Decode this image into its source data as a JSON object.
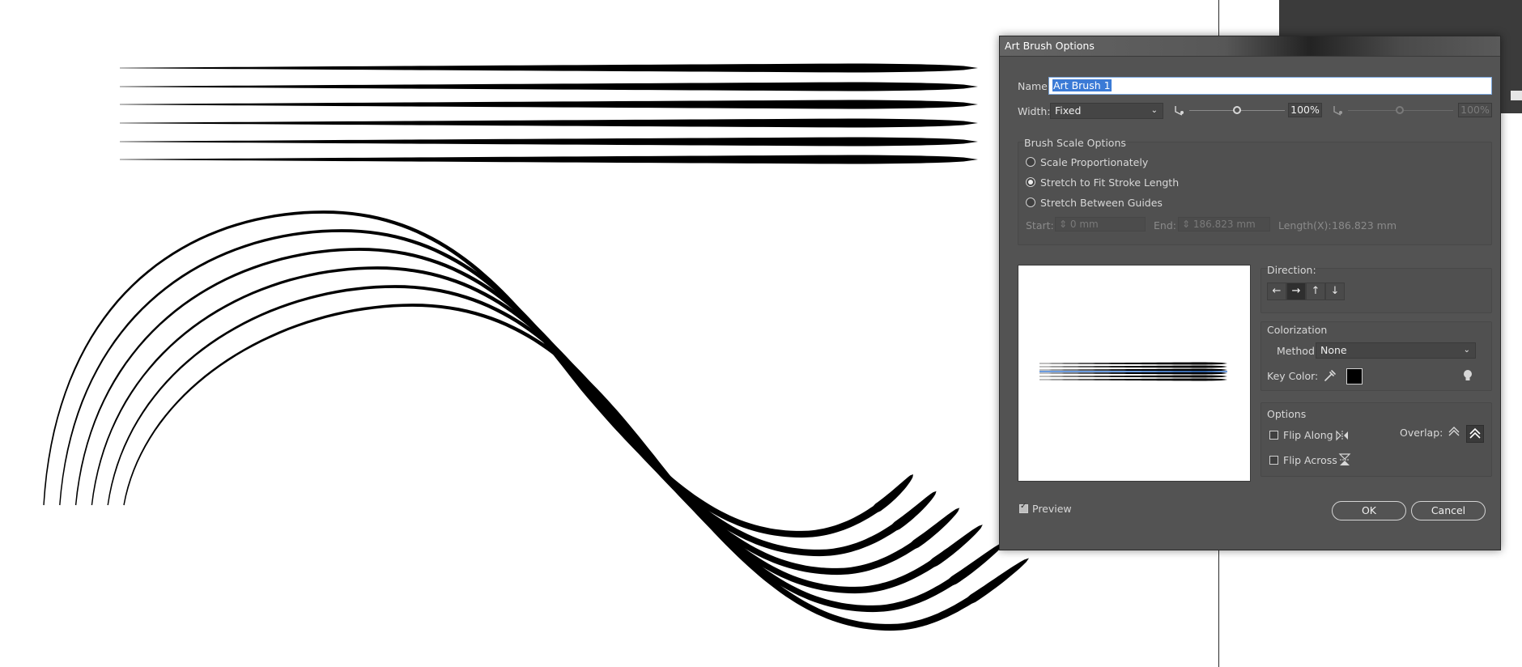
{
  "dialog": {
    "title": "Art Brush Options",
    "name_label": "Name:",
    "name_value": "Art Brush 1",
    "width_label": "Width:",
    "width_option": "Fixed",
    "width_percent": "100%",
    "width_percent_2": "100%",
    "width_slider_value": 0.5,
    "brush_scale": {
      "title": "Brush Scale Options",
      "options": [
        "Scale Proportionately",
        "Stretch to Fit Stroke Length",
        "Stretch Between Guides"
      ],
      "selected_index": 1,
      "start_label": "Start:",
      "start_value": "0 mm",
      "end_label": "End:",
      "end_value": "186.823 mm",
      "length_label": "Length(X):",
      "length_value": "186.823 mm"
    },
    "direction": {
      "title": "Direction:",
      "buttons": [
        "←",
        "→",
        "↑",
        "↓"
      ],
      "selected_index": 1
    },
    "colorization": {
      "title": "Colorization",
      "method_label": "Method:",
      "method_value": "None",
      "key_color_label": "Key Color:",
      "key_color": "#000000"
    },
    "options": {
      "title": "Options",
      "flip_along": "Flip Along",
      "flip_across": "Flip Across",
      "overlap_label": "Overlap:"
    },
    "preview_label": "Preview",
    "preview_checked": true,
    "ok_label": "OK",
    "cancel_label": "Cancel",
    "icons": {
      "width_left": "pressure-left-icon",
      "width_right": "pressure-right-icon",
      "eyedropper": "eyedropper-icon",
      "tips": "lightbulb-icon",
      "flip_along": "flip-along-icon",
      "flip_across": "flip-across-icon",
      "overlap_1": "overlap-adjust-icon",
      "overlap_2": "overlap-none-icon"
    }
  },
  "colors": {
    "dialog_bg": "#535353",
    "accent_selection": "#3b7bd6",
    "stroke": "#000000"
  }
}
